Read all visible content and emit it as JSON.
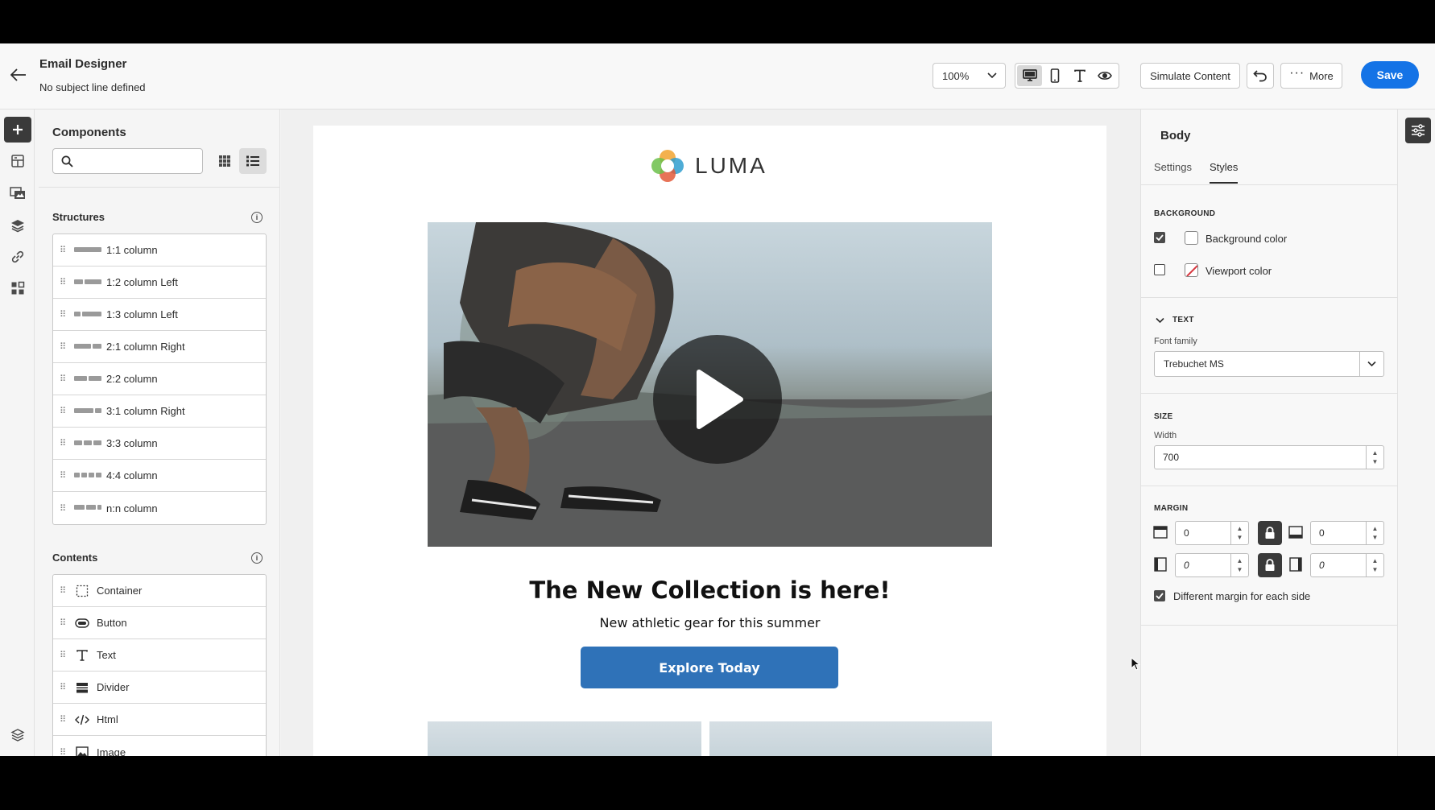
{
  "header": {
    "title": "Email Designer",
    "subtitle": "No subject line defined",
    "zoom": "100%",
    "simulate_label": "Simulate Content",
    "more_label": "More",
    "save_label": "Save"
  },
  "left_rail": {
    "items": [
      "add-icon",
      "fragments-icon",
      "assets-icon",
      "layers-icon",
      "link-icon",
      "components-icon",
      "settings-layers-icon"
    ]
  },
  "components": {
    "title": "Components",
    "search_placeholder": "",
    "structures_heading": "Structures",
    "structures": [
      {
        "label": "1:1 column",
        "cols": [
          1
        ]
      },
      {
        "label": "1:2 column Left",
        "cols": [
          1,
          2
        ]
      },
      {
        "label": "1:3 column Left",
        "cols": [
          1,
          3
        ]
      },
      {
        "label": "2:1 column Right",
        "cols": [
          2,
          1
        ]
      },
      {
        "label": "2:2 column",
        "cols": [
          1,
          1
        ]
      },
      {
        "label": "3:1 column Right",
        "cols": [
          3,
          1
        ]
      },
      {
        "label": "3:3 column",
        "cols": [
          1,
          1,
          1
        ]
      },
      {
        "label": "4:4 column",
        "cols": [
          1,
          1,
          1,
          1
        ]
      },
      {
        "label": "n:n column",
        "cols": [
          1,
          1,
          0.4
        ]
      }
    ],
    "contents_heading": "Contents",
    "contents": [
      {
        "label": "Container",
        "icon": "container-icon"
      },
      {
        "label": "Button",
        "icon": "button-icon"
      },
      {
        "label": "Text",
        "icon": "text-icon"
      },
      {
        "label": "Divider",
        "icon": "divider-icon"
      },
      {
        "label": "Html",
        "icon": "html-icon"
      },
      {
        "label": "Image",
        "icon": "image-icon"
      }
    ]
  },
  "email": {
    "logo_text": "LUMA",
    "headline": "The New Collection is here!",
    "subheadline": "New athletic gear for this summer",
    "cta_label": "Explore Today"
  },
  "properties": {
    "title": "Body",
    "tabs": [
      "Settings",
      "Styles"
    ],
    "active_tab": "Styles",
    "background_caption": "BACKGROUND",
    "background_color_label": "Background color",
    "background_color_checked": true,
    "viewport_color_label": "Viewport color",
    "viewport_color_checked": false,
    "text_caption": "TEXT",
    "font_family_label": "Font family",
    "font_family_value": "Trebuchet MS",
    "size_caption": "SIZE",
    "width_label": "Width",
    "width_value": "700",
    "margin_caption": "MARGIN",
    "margin_top": "0",
    "margin_bottom": "0",
    "margin_left": "0",
    "margin_right": "0",
    "different_margin_label": "Different margin for each side",
    "different_margin_checked": true
  },
  "colors": {
    "accent": "#1473e6",
    "cta": "#2f72b8",
    "dark_button": "#3a3a3a"
  }
}
